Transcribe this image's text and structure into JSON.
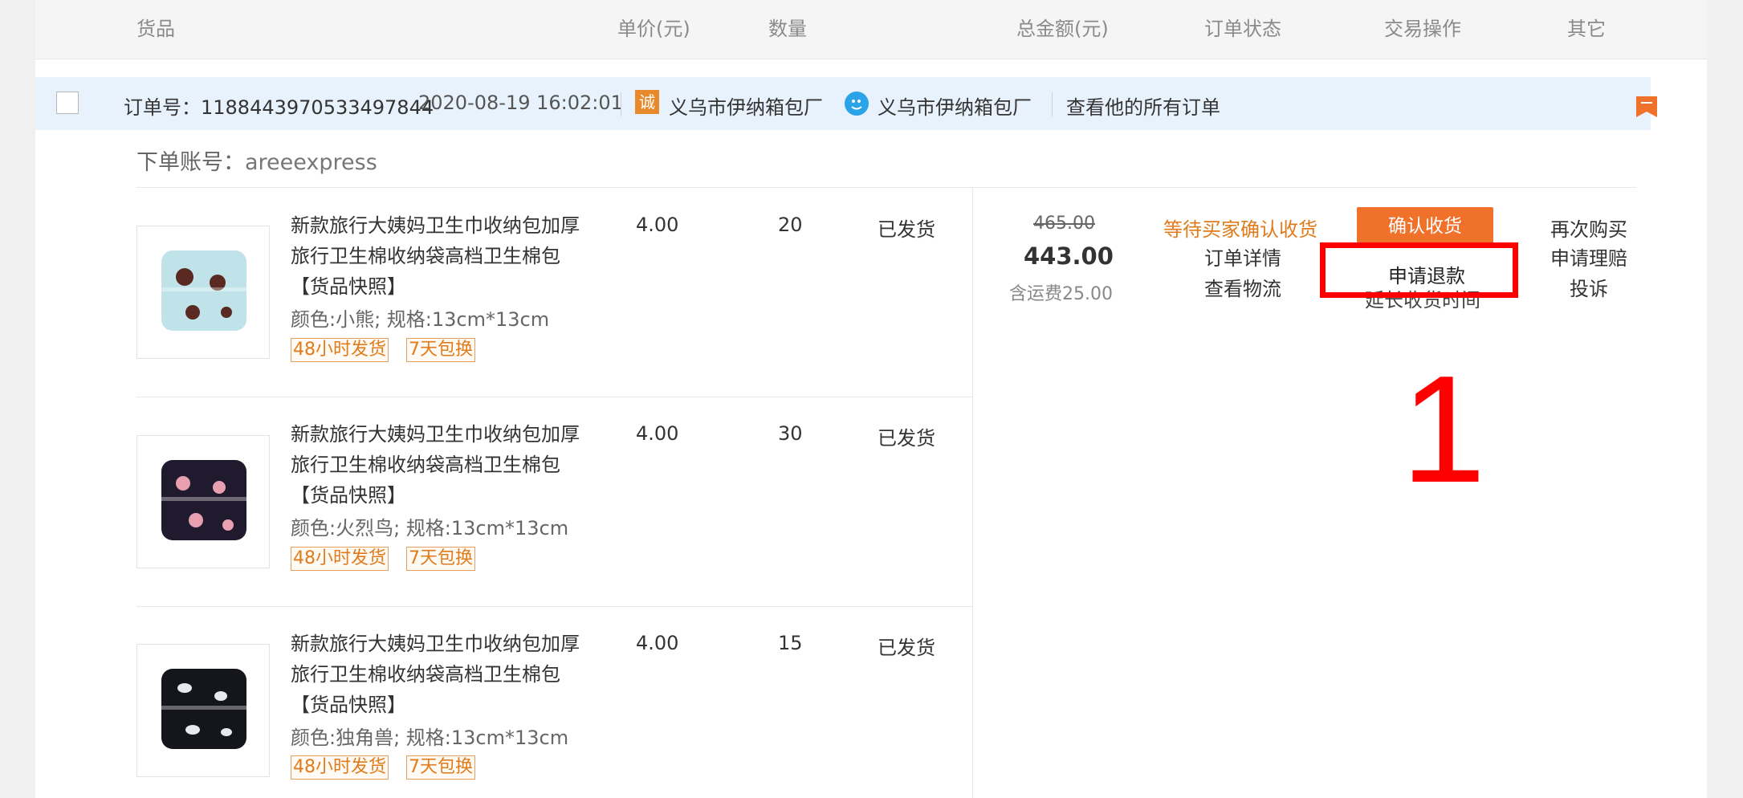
{
  "header": {
    "goods": "货品",
    "unit_price": "单价(元)",
    "quantity": "数量",
    "total": "总金额(元)",
    "order_status": "订单状态",
    "trade_ops": "交易操作",
    "other": "其它"
  },
  "order_bar": {
    "order_no": "订单号：1188443970533497844",
    "datetime": "2020-08-19 16:02:01",
    "cheng_badge": "诚",
    "seller_store": "义乌市伊纳箱包厂",
    "seller_ww": "义乌市伊纳箱包厂",
    "view_all": "查看他的所有订单"
  },
  "account": {
    "label": "下单账号：",
    "value": "areeexpress"
  },
  "items": [
    {
      "title": "新款旅行大姨妈卫生巾收纳包加厚旅行卫生棉收纳袋高档卫生棉包 【货品快照】",
      "spec": "颜色:小熊;  规格:13cm*13cm",
      "tag1": "48小时发货",
      "tag2": "7天包换",
      "price": "4.00",
      "qty": "20",
      "status": "已发货"
    },
    {
      "title": "新款旅行大姨妈卫生巾收纳包加厚旅行卫生棉收纳袋高档卫生棉包 【货品快照】",
      "spec": "颜色:火烈鸟;  规格:13cm*13cm",
      "tag1": "48小时发货",
      "tag2": "7天包换",
      "price": "4.00",
      "qty": "30",
      "status": "已发货"
    },
    {
      "title": "新款旅行大姨妈卫生巾收纳包加厚旅行卫生棉收纳袋高档卫生棉包 【货品快照】",
      "spec": "颜色:独角兽;  规格:13cm*13cm",
      "tag1": "48小时发货",
      "tag2": "7天包换",
      "price": "4.00",
      "qty": "15",
      "status": "已发货"
    }
  ],
  "summary": {
    "original_total": "465.00",
    "total": "443.00",
    "shipping": "含运费25.00",
    "status": "等待买家确认收货",
    "order_detail": "订单详情",
    "view_logistics": "查看物流"
  },
  "actions": {
    "confirm_receipt": "确认收货",
    "request_refund": "申请退款",
    "extend_receipt": "延长收货时间"
  },
  "other": {
    "buy_again": "再次购买",
    "claim": "申请理赔",
    "complain": "投诉"
  },
  "annotation": {
    "step_number": "1"
  },
  "colors": {
    "accent_orange": "#f07129",
    "highlight_red": "#ff0000",
    "order_bar_bg": "#e8f2fc"
  },
  "icons": {
    "seller_badge": "cheng-badge-icon",
    "wangwang": "wangwang-chat-icon",
    "bookmark": "bookmark-flag-icon"
  }
}
